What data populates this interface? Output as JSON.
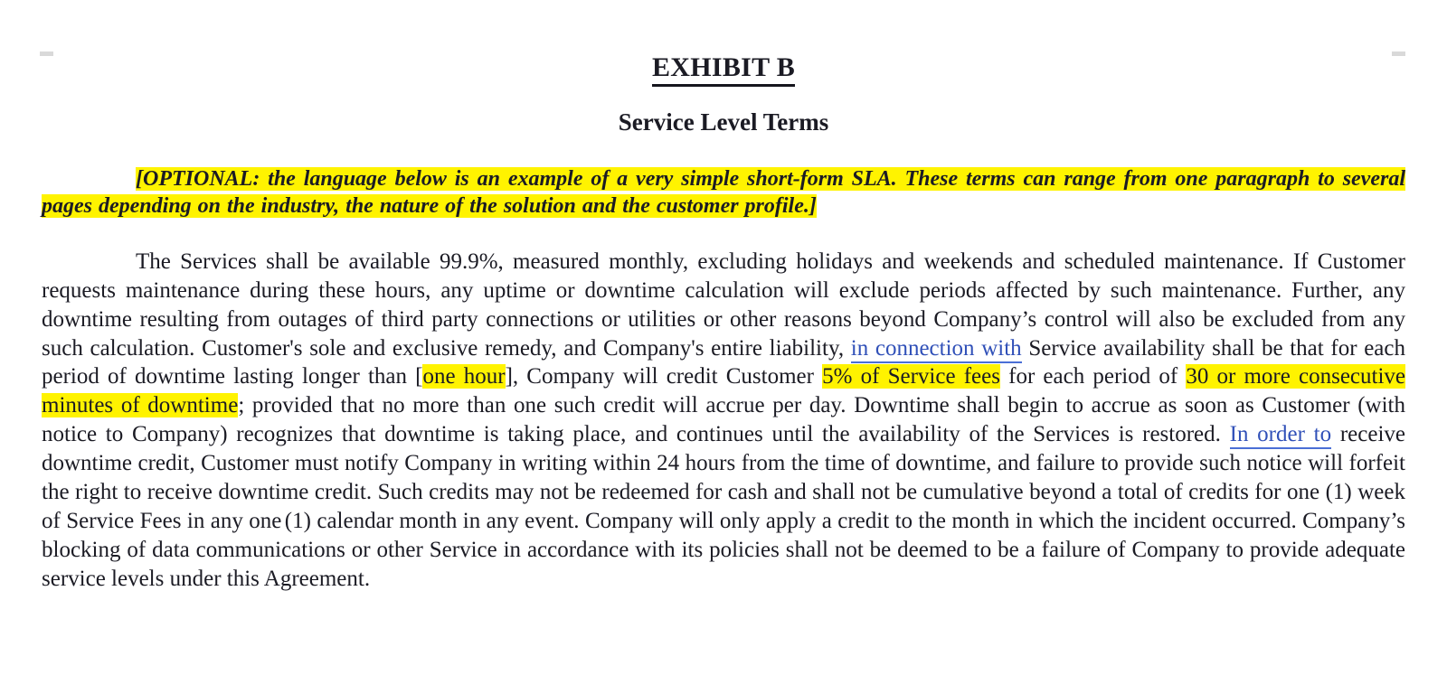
{
  "document": {
    "title": "EXHIBIT B",
    "subtitle": "Service Level Terms",
    "optional_note": "[OPTIONAL: the language below is an example of a very simple short-form SLA.  These terms can range from one paragraph to several pages depending on the industry, the nature of the solution and the customer profile.]",
    "paragraph": {
      "seg_1": "The Services shall be available 99.9%, measured monthly, excluding holidays and weekends and scheduled maintenance.  If Customer requests maintenance during these hours, any uptime or downtime calculation will exclude periods affected by such maintenance.  Further, any downtime resulting from outages of third party connections or utilities or other reasons beyond Company’s control will also be excluded from any such calculation. Customer's sole and exclusive remedy, and Company's entire liability, ",
      "suggestion_1": "in connection with",
      "seg_2": " Service availability shall be that for each period of downtime lasting longer than [",
      "highlight_1": "one hour",
      "seg_3": "], Company will credit Customer ",
      "highlight_2": "5% of Service fees",
      "seg_4": " for each period of ",
      "highlight_3": "30 or more consecutive minutes of downtime",
      "seg_5": "; provided that no more than one such credit will accrue per day.  Downtime shall begin to accrue as soon as Customer (with notice to Company) recognizes that downtime is taking place, and continues until the availability of the Services is restored.  ",
      "suggestion_2": "In order to",
      "seg_6": " receive downtime credit, Customer must notify Company in writing within 24 hours from the time of downtime, and failure to provide such notice will forfeit the right to receive downtime credit.  Such credits may not be redeemed for cash and shall not be cumulative beyond a total of credits for one (1) week of Service Fees in any ",
      "seg_7": "one (1)",
      "seg_8": " calendar month in any event.  Company will only apply a credit to the month in which the incident occurred.  Company’s blocking of data communications or other Service in accordance with its policies shall not be deemed to be a failure of Company to provide adequate service levels under this Agreement."
    }
  },
  "colors": {
    "highlight": "#fff300",
    "suggestion_text": "#3050b8",
    "suggestion_underline": "#4a6fd6",
    "body_text": "#1b1b24",
    "page_background": "#ffffff"
  }
}
